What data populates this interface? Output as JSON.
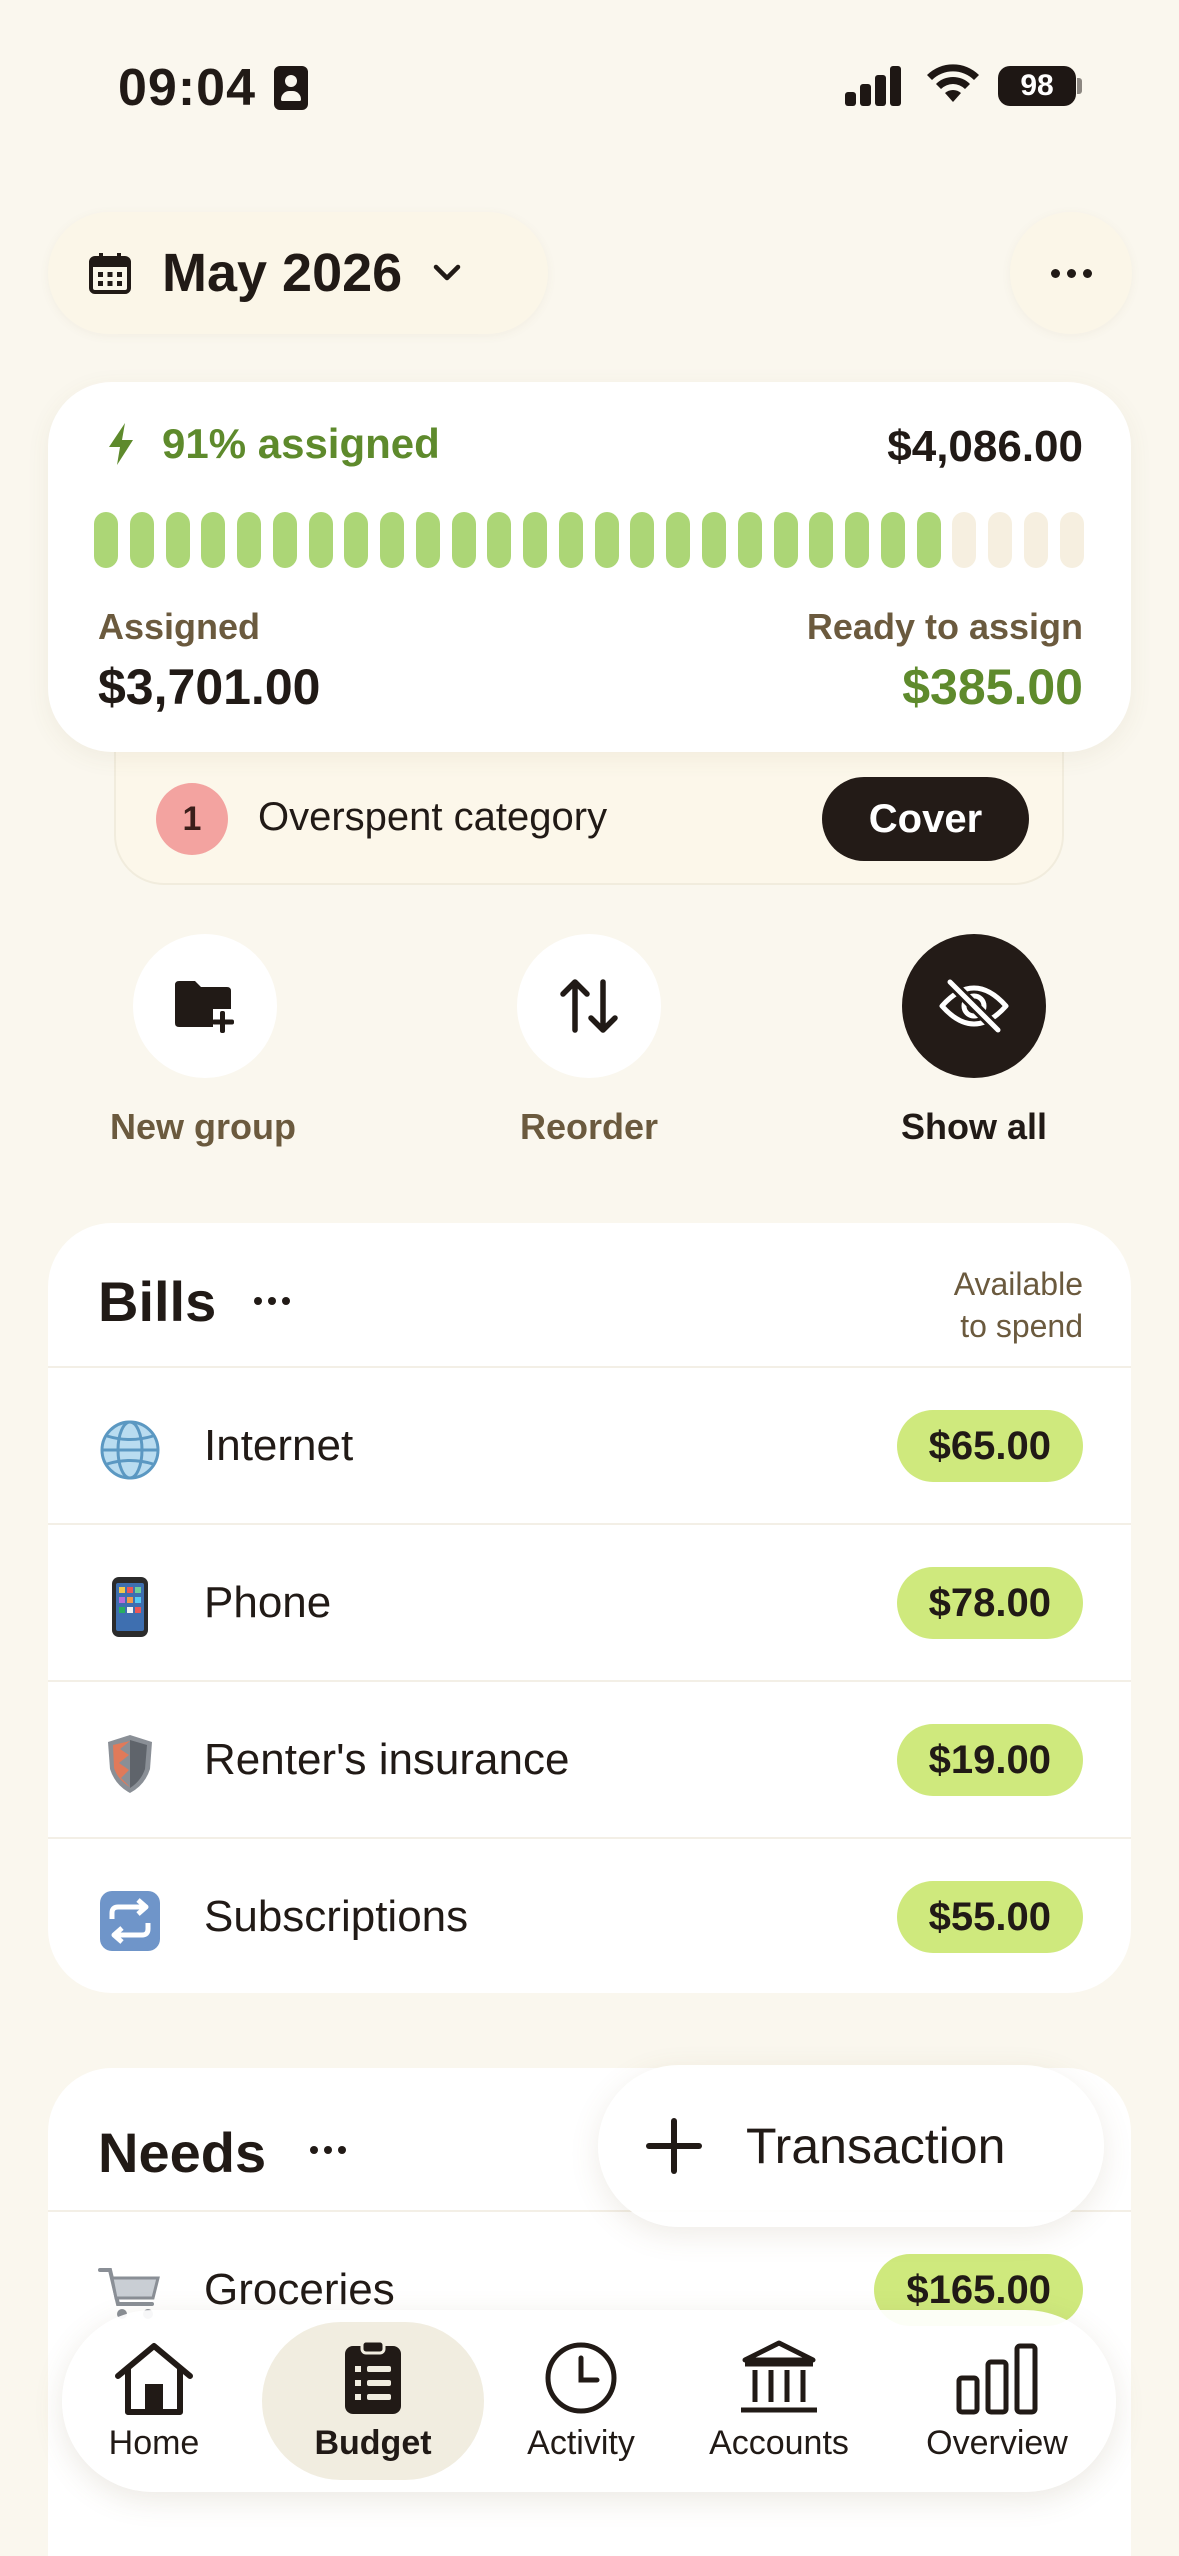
{
  "status_bar": {
    "time": "09:04",
    "battery": "98",
    "icons": [
      "id-card-icon",
      "signal-icon",
      "wifi-icon",
      "battery-icon"
    ]
  },
  "header": {
    "month": "May 2026",
    "icons": [
      "calendar-icon",
      "chevron-down-icon",
      "more-icon"
    ]
  },
  "summary": {
    "assigned_pct_label": "91% assigned",
    "assigned_fraction": 0.91,
    "total": "$4,086.00",
    "assigned_label": "Assigned",
    "assigned_value": "$3,701.00",
    "ready_label": "Ready to assign",
    "ready_value": "$385.00"
  },
  "overspent": {
    "count": "1",
    "text": "Overspent category",
    "action": "Cover"
  },
  "quick_actions": [
    {
      "label": "New group",
      "icon": "folder-plus-icon"
    },
    {
      "label": "Reorder",
      "icon": "sort-arrows-icon"
    },
    {
      "label": "Show all",
      "icon": "eye-off-icon"
    }
  ],
  "bills": {
    "title": "Bills",
    "available_line1": "Available",
    "available_line2": "to spend",
    "rows": [
      {
        "label": "Internet",
        "amount": "$65.00",
        "icon": "globe-icon"
      },
      {
        "label": "Phone",
        "amount": "$78.00",
        "icon": "phone-icon"
      },
      {
        "label": "Renter's insurance",
        "amount": "$19.00",
        "icon": "shield-icon"
      },
      {
        "label": "Subscriptions",
        "amount": "$55.00",
        "icon": "repeat-icon"
      }
    ]
  },
  "needs": {
    "title": "Needs",
    "rows": [
      {
        "label": "Groceries",
        "amount": "$165.00",
        "icon": "cart-icon"
      }
    ]
  },
  "fab": {
    "label": "Transaction"
  },
  "tabs": [
    {
      "label": "Home",
      "icon": "home-icon"
    },
    {
      "label": "Budget",
      "icon": "clipboard-icon",
      "active": true
    },
    {
      "label": "Activity",
      "icon": "clock-icon"
    },
    {
      "label": "Accounts",
      "icon": "bank-icon"
    },
    {
      "label": "Overview",
      "icon": "bar-chart-icon"
    }
  ],
  "colors": {
    "background": "#faf7ee",
    "accent_green": "#5e8a2c",
    "pill_green": "#cfe97d",
    "bar_green": "#acd676",
    "dark": "#231b17",
    "overspent_badge": "#f3a3a0"
  }
}
